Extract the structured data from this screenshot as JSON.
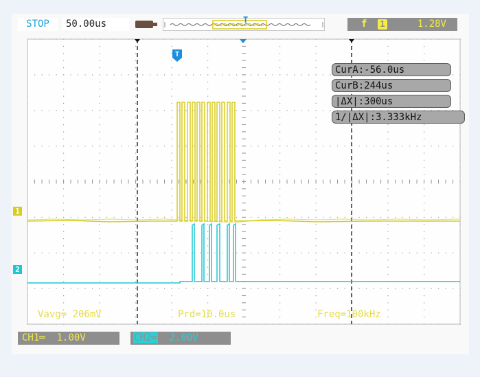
{
  "status": {
    "run_state": "STOP",
    "timebase": "50.00us"
  },
  "trigger": {
    "edge_symbol": "f",
    "source": "1",
    "level": "1.28V",
    "marker_label": "T"
  },
  "cursors": {
    "cur_a": "CurA:-56.0us",
    "cur_b": "CurB:244us",
    "delta_x": "|ΔX|:300us",
    "inv_delta_x": "1/|ΔX|:3.333kHz"
  },
  "measurements": {
    "vavg": "Vavg= 206mV",
    "period": "Prd=10.0us",
    "frequency": "Freq=100kHz"
  },
  "channels": {
    "ch1": {
      "name": "CH1",
      "coupling": "═",
      "scale": "1.00V",
      "marker": "1",
      "color": "#d8cc1c"
    },
    "ch2": {
      "name": "CH2",
      "coupling": "═",
      "scale": "2.00V",
      "marker": "2",
      "color": "#1ec6d4"
    }
  },
  "icons": [
    "battery-icon",
    "memory-position-bar",
    "trigger-position-marker",
    "cursor-marker"
  ]
}
